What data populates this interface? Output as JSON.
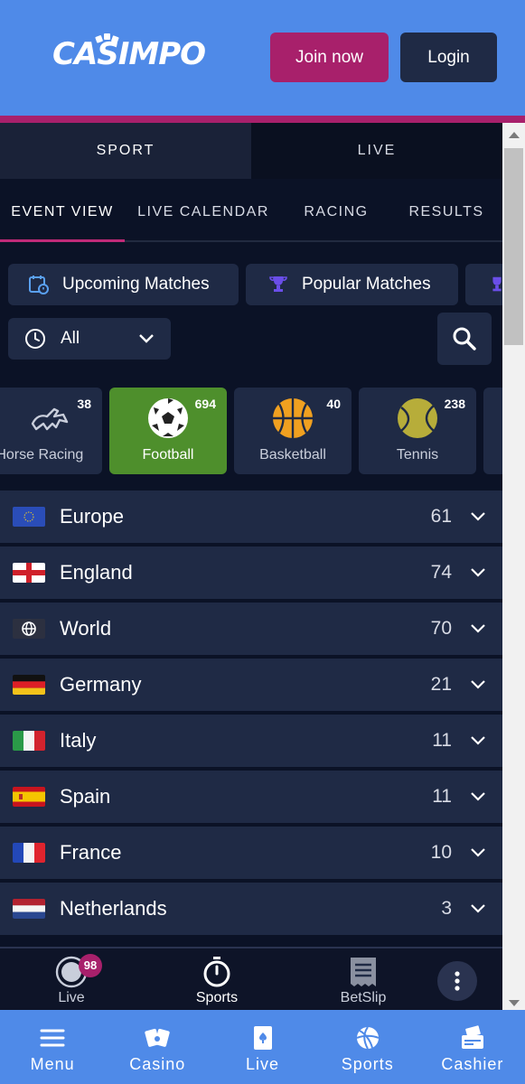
{
  "header": {
    "logo_text": "CASIMPO",
    "join_label": "Join now",
    "login_label": "Login"
  },
  "mode_tabs": [
    {
      "label": "SPORT",
      "active": true
    },
    {
      "label": "LIVE",
      "active": false
    }
  ],
  "sub_tabs": [
    {
      "label": "EVENT VIEW",
      "active": true
    },
    {
      "label": "LIVE CALENDAR",
      "active": false
    },
    {
      "label": "RACING",
      "active": false
    },
    {
      "label": "RESULTS",
      "active": false
    }
  ],
  "filters": {
    "upcoming": "Upcoming Matches",
    "popular": "Popular Matches",
    "time_select": "All"
  },
  "sports": [
    {
      "name": "Horse Racing",
      "visible_name": "e Horse Racing",
      "count": "38",
      "icon": "horse-icon"
    },
    {
      "name": "Football",
      "count": "694",
      "icon": "football-icon",
      "active": true
    },
    {
      "name": "Basketball",
      "count": "40",
      "icon": "basketball-icon"
    },
    {
      "name": "Tennis",
      "count": "238",
      "icon": "tennis-icon"
    }
  ],
  "countries": [
    {
      "name": "Europe",
      "count": "61"
    },
    {
      "name": "England",
      "count": "74"
    },
    {
      "name": "World",
      "count": "70"
    },
    {
      "name": "Germany",
      "count": "21"
    },
    {
      "name": "Italy",
      "count": "11"
    },
    {
      "name": "Spain",
      "count": "11"
    },
    {
      "name": "France",
      "count": "10"
    },
    {
      "name": "Netherlands",
      "count": "3"
    }
  ],
  "bottom_sub": {
    "live_label": "Live",
    "live_badge": "98",
    "sports_label": "Sports",
    "betslip_label": "BetSlip"
  },
  "bottom_nav": [
    {
      "label": "Menu",
      "icon": "menu-icon"
    },
    {
      "label": "Casino",
      "icon": "cards-icon"
    },
    {
      "label": "Live",
      "icon": "playing-card-icon"
    },
    {
      "label": "Sports",
      "icon": "volleyball-icon"
    },
    {
      "label": "Cashier",
      "icon": "cashier-icon"
    }
  ],
  "colors": {
    "header_bg": "#4f8ae8",
    "accent": "#a8206b",
    "panel_bg": "#1f2a45",
    "page_bg": "#0b1226",
    "football_active": "#4e8f2c"
  }
}
